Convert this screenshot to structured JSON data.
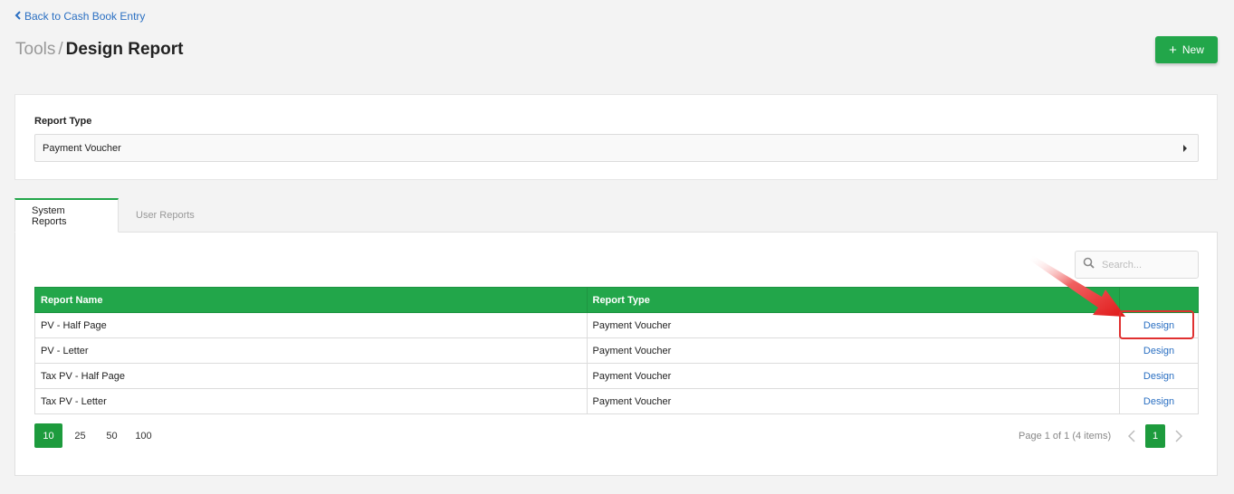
{
  "header": {
    "back_label": "Back to Cash Book Entry",
    "breadcrumb_parent": "Tools",
    "breadcrumb_sep": "/",
    "title": "Design Report",
    "new_label": "New"
  },
  "filter": {
    "label": "Report Type",
    "selected": "Payment Voucher"
  },
  "tabs": [
    {
      "label": "System Reports"
    },
    {
      "label": "User Reports"
    }
  ],
  "search": {
    "placeholder": "Search..."
  },
  "table": {
    "columns": [
      "Report Name",
      "Report Type",
      ""
    ],
    "rows": [
      {
        "name": "PV - Half Page",
        "type": "Payment Voucher",
        "action": "Design"
      },
      {
        "name": "PV - Letter",
        "type": "Payment Voucher",
        "action": "Design"
      },
      {
        "name": "Tax PV - Half Page",
        "type": "Payment Voucher",
        "action": "Design"
      },
      {
        "name": "Tax PV - Letter",
        "type": "Payment Voucher",
        "action": "Design"
      }
    ]
  },
  "pagination": {
    "sizes": [
      "10",
      "25",
      "50",
      "100"
    ],
    "info": "Page 1 of 1 (4 items)",
    "current_page": "1"
  },
  "colors": {
    "accent": "#22a64a",
    "link": "#2a6fc2",
    "highlight": "#e03030"
  }
}
